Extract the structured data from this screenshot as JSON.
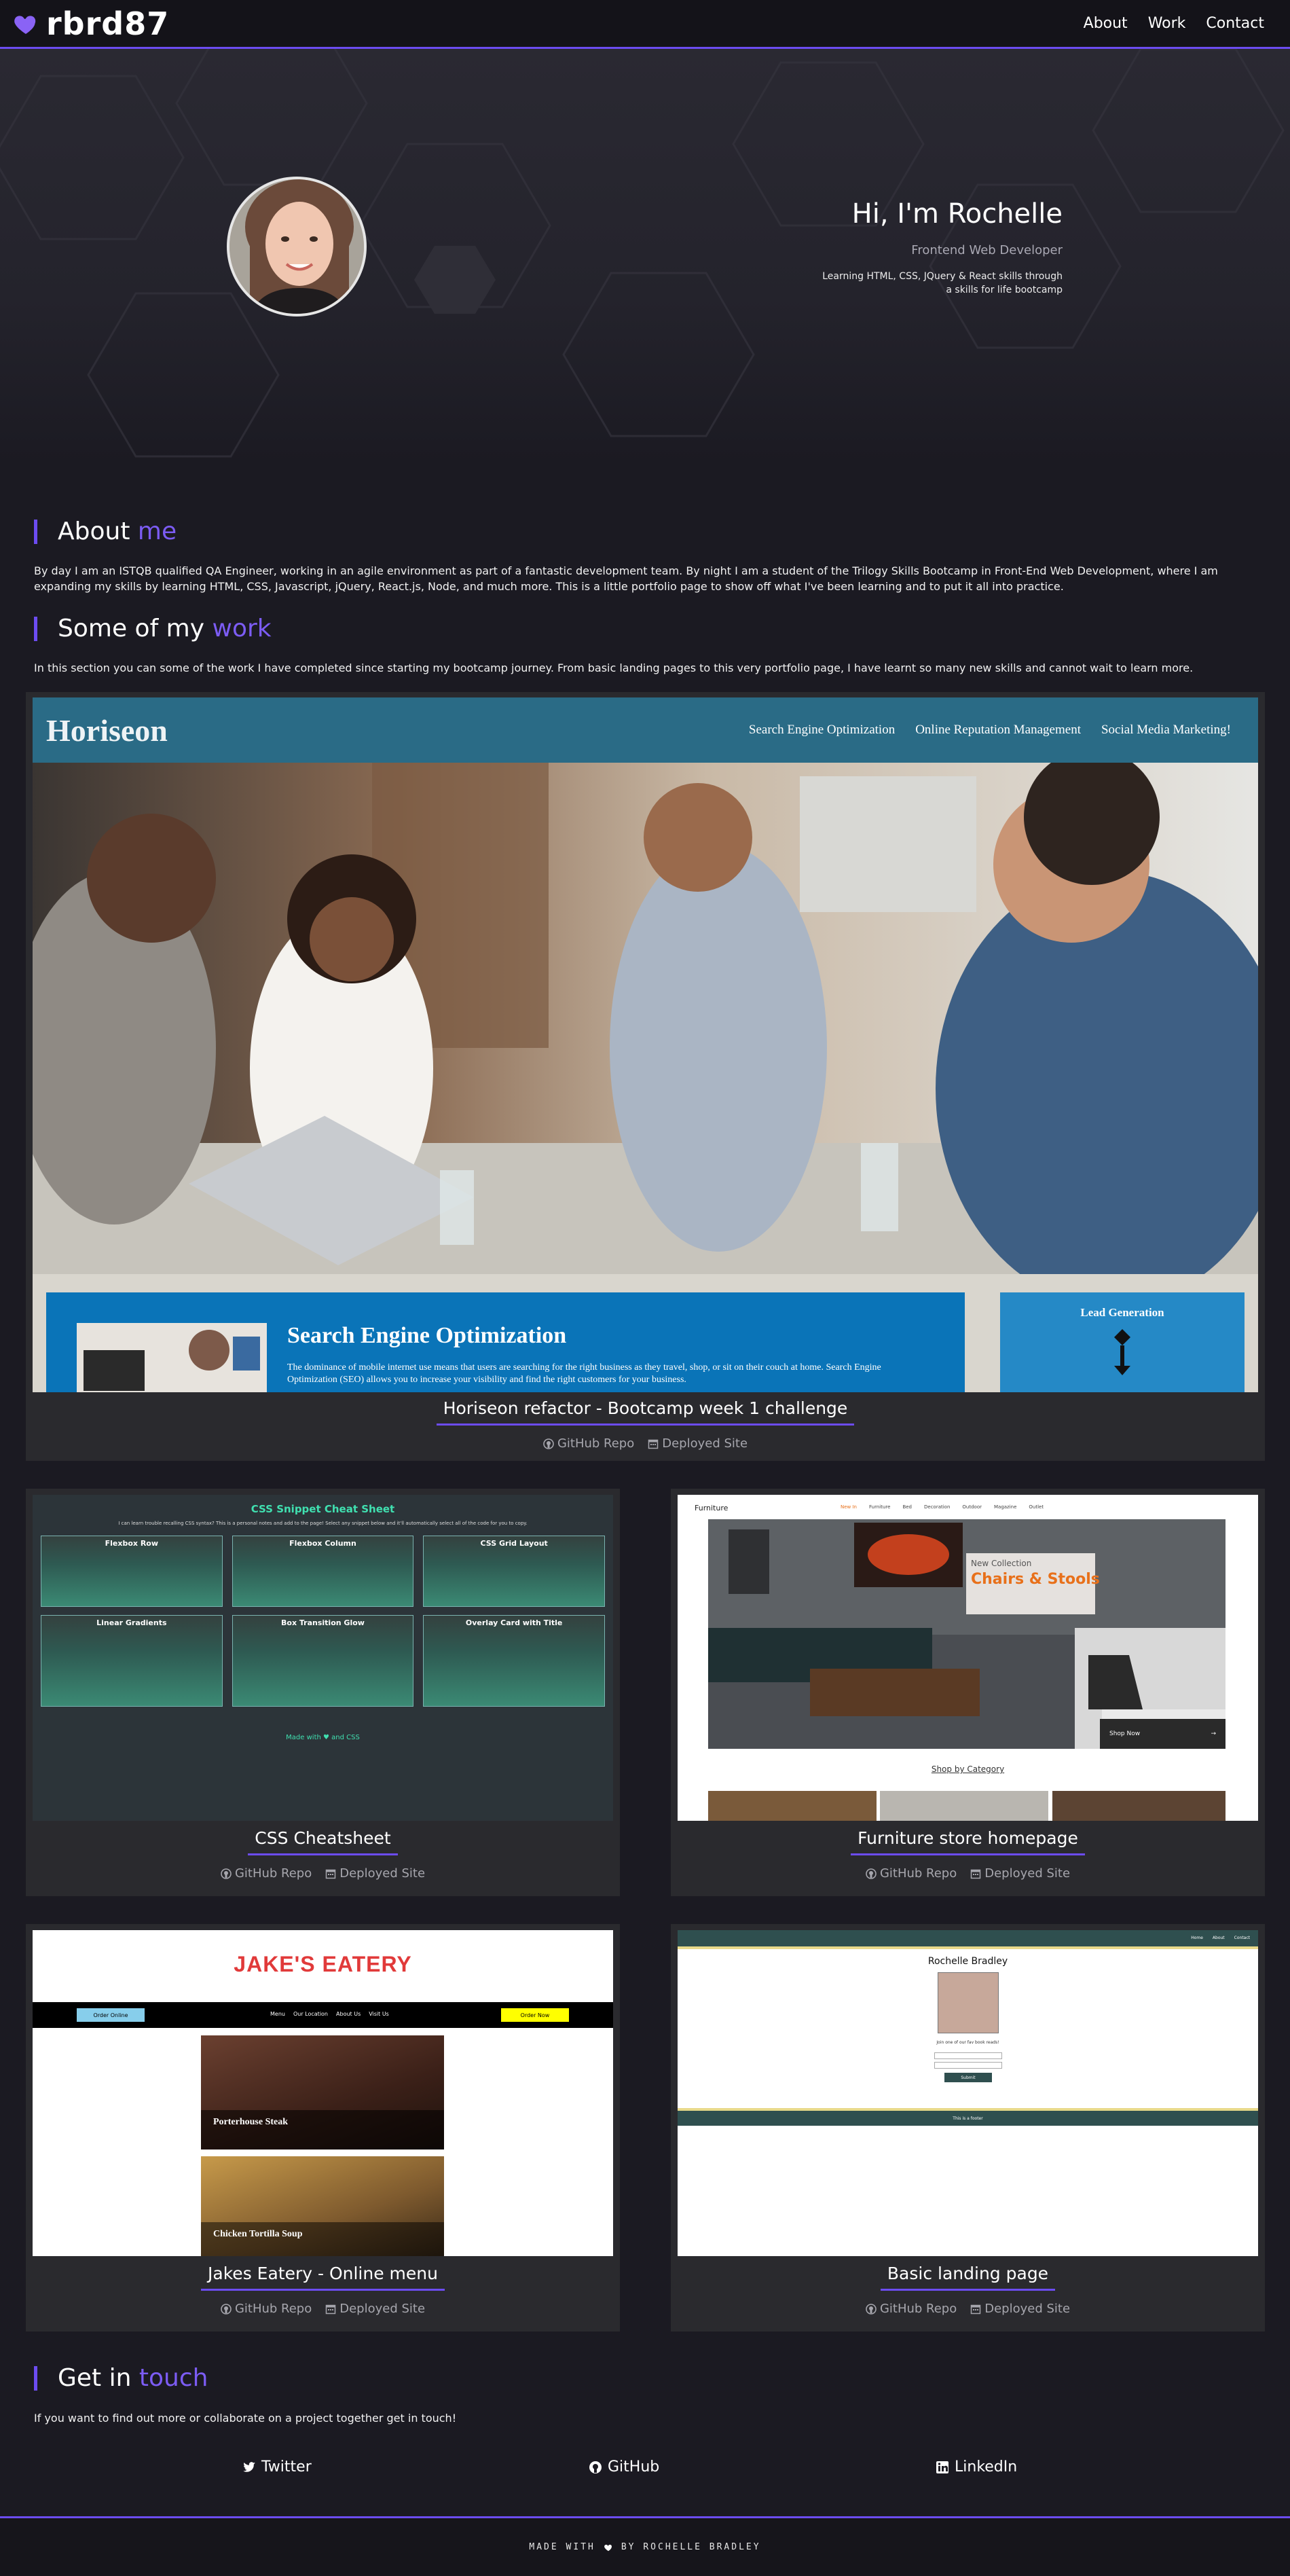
{
  "nav": {
    "brand": "rbrd87",
    "links": [
      "About",
      "Work",
      "Contact"
    ]
  },
  "hero": {
    "title": "Hi, I'm Rochelle",
    "subtitle": "Frontend Web Developer",
    "description_line1": "Learning HTML, CSS, JQuery & React skills through",
    "description_line2": "a skills for life bootcamp"
  },
  "about": {
    "title_prefix": "About ",
    "title_accent": "me",
    "text": "By day I am an ISTQB qualified QA Engineer, working in an agile environment as part of a fantastic development team. By night I am a student of the Trilogy Skills Bootcamp in Front-End Web Development, where I am expanding my skills by learning HTML, CSS, Javascript, jQuery, React.js, Node, and much more. This is a little portfolio page to show off what I've been learning and to put it all into practice."
  },
  "work": {
    "title_prefix": "Some of my ",
    "title_accent": "work",
    "text": "In this section you can some of the work I have completed since starting my bootcamp journey. From basic landing pages to this very portfolio page, I have learnt so many new skills and cannot wait to learn more.",
    "projects": [
      {
        "title": "Horiseon refactor - Bootcamp week 1 challenge",
        "repo_label": "GitHub Repo",
        "site_label": "Deployed Site",
        "preview": {
          "logo": "Horiseon",
          "nav": [
            "Search Engine Optimization",
            "Online Reputation Management",
            "Social Media Marketing!"
          ],
          "panel_title": "Search Engine Optimization",
          "panel_text": "The dominance of mobile internet use means that users are searching for the right business as they travel, shop, or sit on their couch at home. Search Engine Optimization (SEO) allows you to increase your visibility and find the right customers for your business.",
          "side_title": "Lead Generation"
        }
      },
      {
        "title": "CSS Cheatsheet",
        "repo_label": "GitHub Repo",
        "site_label": "Deployed Site",
        "preview": {
          "heading": "CSS Snippet Cheat Sheet",
          "intro": "I can learn trouble recalling CSS syntax? This is a personal notes and add to the page! Select any snippet below and it'll automatically select all of the code for you to copy.",
          "boxes": [
            "Flexbox Row",
            "Flexbox Column",
            "CSS Grid Layout",
            "Linear Gradients",
            "Box Transition Glow",
            "Overlay Card with Title"
          ],
          "footer": "Made with ♥ and CSS"
        }
      },
      {
        "title": "Furniture store homepage",
        "repo_label": "GitHub Repo",
        "site_label": "Deployed Site",
        "preview": {
          "brand": "Furniture",
          "nav": [
            "New In",
            "Furniture",
            "Bed",
            "Decoration",
            "Outdoor",
            "Magazine",
            "Outlet"
          ],
          "collection": "New Collection",
          "headline": "Chairs & Stools",
          "shop_now": "Shop Now",
          "category": "Shop by Category"
        }
      },
      {
        "title": "Jakes Eatery - Online menu",
        "repo_label": "GitHub Repo",
        "site_label": "Deployed Site",
        "preview": {
          "logo": "JAKE'S EATERY",
          "order": "Order Online",
          "nav": [
            "Menu",
            "Our Location",
            "About Us",
            "Visit Us"
          ],
          "order_now": "Order Now",
          "dish1": "Porterhouse Steak",
          "dish2": "Chicken Tortilla Soup"
        }
      },
      {
        "title": "Basic landing page",
        "repo_label": "GitHub Repo",
        "site_label": "Deployed Site",
        "preview": {
          "nav": [
            "Home",
            "About",
            "Contact"
          ],
          "name": "Rochelle Bradley",
          "tagline": "Join one of our fav book reads!",
          "button": "Submit",
          "footer": "This is a footer"
        }
      }
    ]
  },
  "contact": {
    "title_prefix": "Get in ",
    "title_accent": "touch",
    "text": "If you want to find out more or collaborate on a project together get in touch!",
    "links": [
      "Twitter",
      "GitHub",
      "LinkedIn"
    ]
  },
  "footer": {
    "text_before": "MADE WITH",
    "text_after": "BY ROCHELLE BRADLEY"
  },
  "colors": {
    "accent": "#6c4cf1",
    "background": "#1b1a22",
    "card": "#2a2a2e"
  }
}
